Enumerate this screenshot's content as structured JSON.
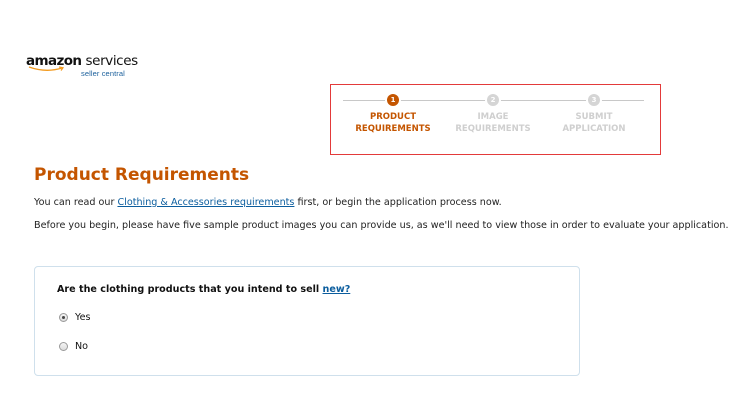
{
  "logo": {
    "brand": "amazon",
    "services": "services",
    "subtitle": "seller central"
  },
  "stepper": {
    "steps": [
      {
        "number": "1",
        "line1": "PRODUCT",
        "line2": "REQUIREMENTS",
        "state": "active"
      },
      {
        "number": "2",
        "line1": "IMAGE",
        "line2": "REQUIREMENTS",
        "state": "inactive"
      },
      {
        "number": "3",
        "line1": "SUBMIT",
        "line2": "APPLICATION",
        "state": "inactive"
      }
    ]
  },
  "main": {
    "title": "Product Requirements",
    "intro_prefix": "You can read our ",
    "intro_link": "Clothing & Accessories requirements",
    "intro_suffix": " first, or begin the application process now.",
    "note": "Before you begin, please have five sample product images you can provide us, as we'll need to view those in order to evaluate your application."
  },
  "question": {
    "text": "Are the clothing products that you intend to sell ",
    "link": "new?",
    "options": [
      {
        "label": "Yes",
        "selected": true
      },
      {
        "label": "No",
        "selected": false
      }
    ]
  },
  "colors": {
    "accent": "#c45500",
    "link": "#0b5d9e",
    "highlight_border": "#e33a3a",
    "inactive_step": "#d5d5d5"
  }
}
